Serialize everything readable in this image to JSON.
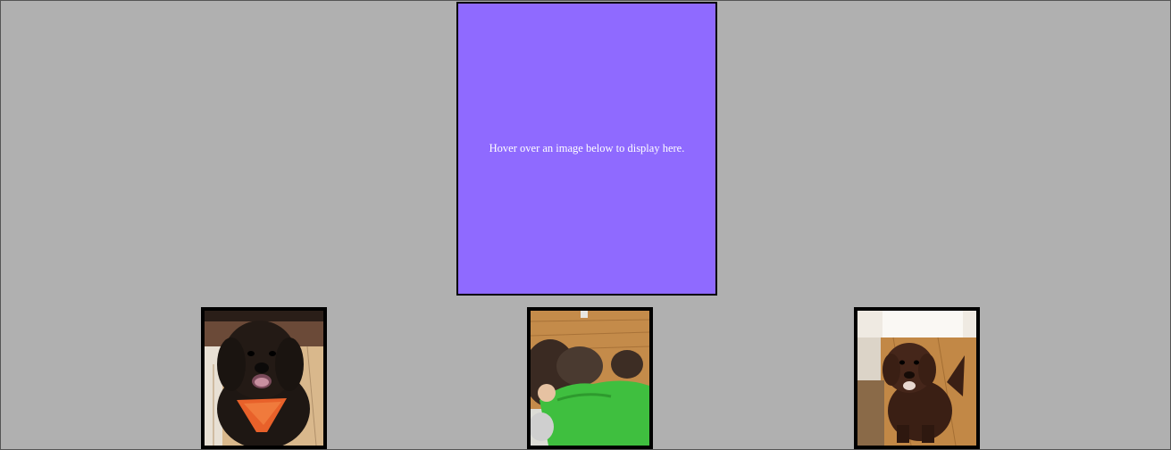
{
  "display": {
    "message": "Hover over an image below to display here.",
    "background": "#8f6aff"
  },
  "page": {
    "background": "#b0b0b0"
  },
  "gallery": {
    "images": [
      {
        "icon": "dog-with-orange-bandana-photo"
      },
      {
        "icon": "child-hugging-dog-photo"
      },
      {
        "icon": "brown-puppy-sitting-photo"
      }
    ]
  }
}
